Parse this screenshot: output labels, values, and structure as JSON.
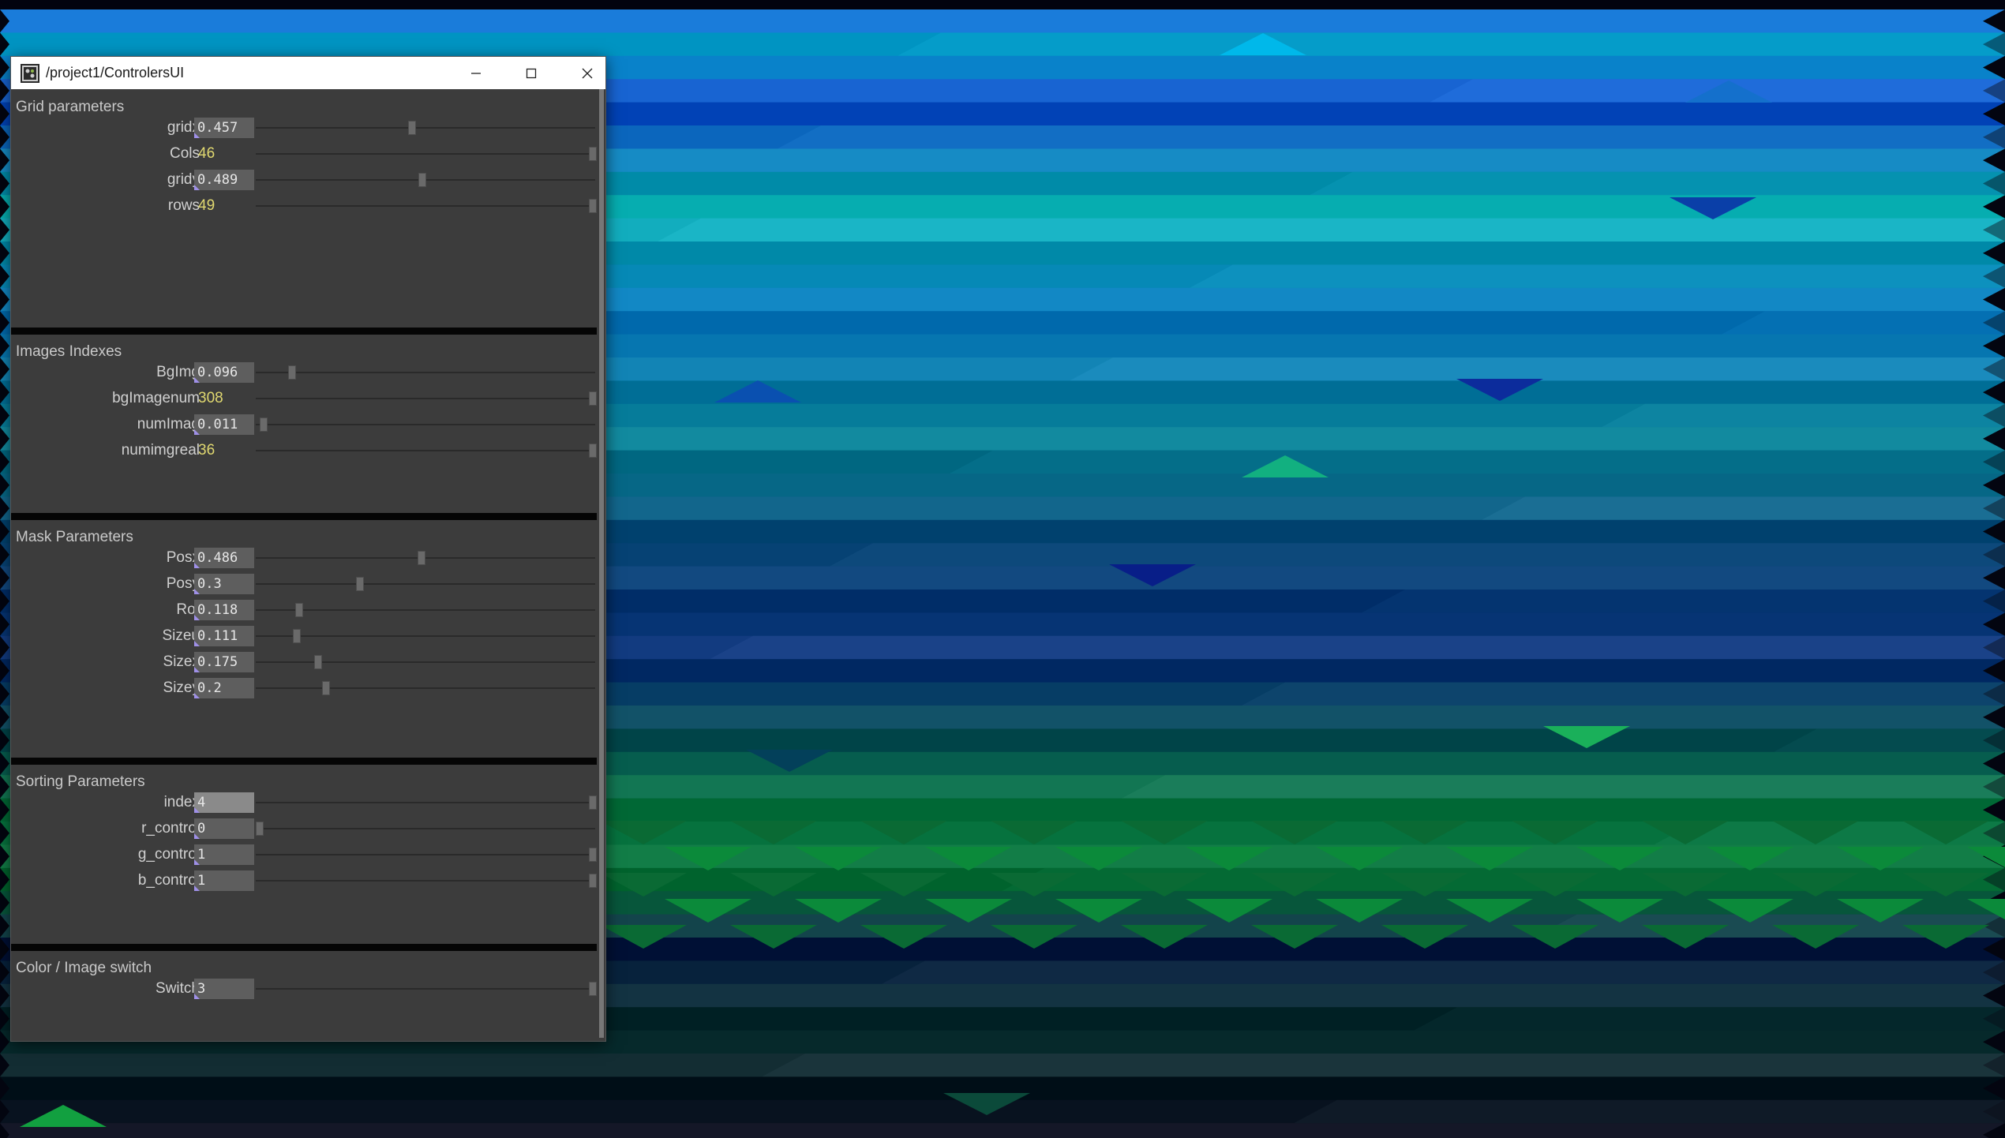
{
  "window": {
    "title": "/project1/ControlersUI"
  },
  "sections": [
    {
      "title": "Grid parameters",
      "params": [
        {
          "label": "gridx",
          "value": "0.457",
          "level": 0.457,
          "kind": "float"
        },
        {
          "label": "Cols",
          "value": "46",
          "level": 1.0,
          "kind": "int"
        },
        {
          "label": "gridy",
          "value": "0.489",
          "level": 0.489,
          "kind": "float"
        },
        {
          "label": "rows",
          "value": "49",
          "level": 1.0,
          "kind": "int"
        }
      ]
    },
    {
      "title": "Images Indexes",
      "params": [
        {
          "label": "BgImg",
          "value": "0.096",
          "level": 0.096,
          "kind": "float"
        },
        {
          "label": "bgImagenum",
          "value": "308",
          "level": 1.0,
          "kind": "int"
        },
        {
          "label": "numImag",
          "value": "0.011",
          "level": 0.011,
          "kind": "float"
        },
        {
          "label": "numimgreal",
          "value": "36",
          "level": 1.0,
          "kind": "int"
        }
      ]
    },
    {
      "title": "Mask Parameters",
      "params": [
        {
          "label": "Posx",
          "value": "0.486",
          "level": 0.486,
          "kind": "float"
        },
        {
          "label": "Posy",
          "value": "0.3",
          "level": 0.3,
          "kind": "float"
        },
        {
          "label": "Rot",
          "value": "0.118",
          "level": 0.118,
          "kind": "float"
        },
        {
          "label": "Sizeu",
          "value": "0.111",
          "level": 0.111,
          "kind": "float"
        },
        {
          "label": "Sizex",
          "value": "0.175",
          "level": 0.175,
          "kind": "float"
        },
        {
          "label": "Sizey",
          "value": "0.2",
          "level": 0.2,
          "kind": "float"
        }
      ]
    },
    {
      "title": "Sorting Parameters",
      "params": [
        {
          "label": "index",
          "value": "4",
          "level": 1.0,
          "kind": "menu",
          "highlight": true
        },
        {
          "label": "r_control",
          "value": "0",
          "level": 0.0,
          "kind": "menu"
        },
        {
          "label": "g_control",
          "value": "1",
          "level": 1.0,
          "kind": "menu"
        },
        {
          "label": "b_control",
          "value": "1",
          "level": 1.0,
          "kind": "menu"
        }
      ]
    },
    {
      "title": "Color / Image switch",
      "params": [
        {
          "label": "Switch",
          "value": "3",
          "level": 1.0,
          "kind": "menu"
        }
      ]
    }
  ]
}
